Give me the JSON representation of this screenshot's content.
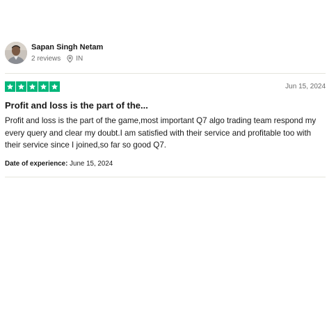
{
  "reviewer": {
    "name": "Sapan Singh Netam",
    "reviews_count": "2 reviews",
    "location": "IN"
  },
  "review": {
    "rating": 5,
    "rating_max": 5,
    "star_color": "#00b67a",
    "date": "Jun 15, 2024",
    "title": "Profit and loss is the part of the...",
    "body": "Profit and loss is the part of the game,most important Q7 algo trading team respond my every query and clear my doubt.I am satisfied with their service and profitable too with their service since I joined,so far so good Q7.",
    "experience_label": "Date of experience:",
    "experience_date": "June 15, 2024"
  },
  "icons": {
    "location": "location-pin-icon",
    "star": "star-icon"
  }
}
